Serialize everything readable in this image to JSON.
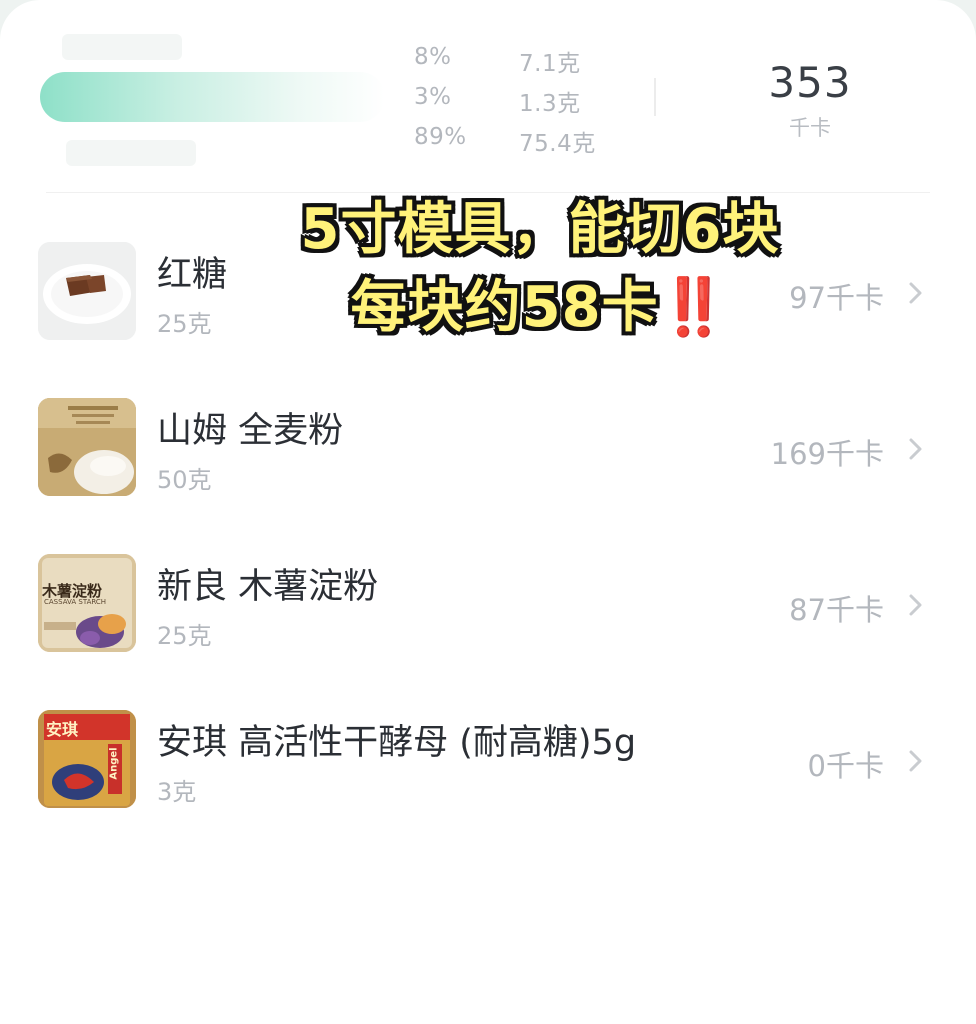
{
  "summary": {
    "macros": [
      {
        "pct": "8%",
        "grams": "7.1克"
      },
      {
        "pct": "3%",
        "grams": "1.3克"
      },
      {
        "pct": "89%",
        "grams": "75.4克"
      }
    ],
    "total_kcal": "353",
    "kcal_unit": "千卡"
  },
  "overlay": {
    "line1": "5寸模具，能切6块",
    "line2": "每块约58卡",
    "emoji": "‼️"
  },
  "foods": [
    {
      "name": "红糖",
      "weight": "25克",
      "kcal": "97千卡",
      "icon": "brown-sugar-photo"
    },
    {
      "name": "山姆 全麦粉",
      "weight": "50克",
      "kcal": "169千卡",
      "icon": "whole-wheat-flour-photo"
    },
    {
      "name": "新良 木薯淀粉",
      "weight": "25克",
      "kcal": "87千卡",
      "icon": "tapioca-starch-photo"
    },
    {
      "name": "安琪 高活性干酵母 (耐高糖)5g",
      "weight": "3克",
      "kcal": "0千卡",
      "icon": "yeast-packet-photo"
    }
  ],
  "thumb_texts": {
    "starch_title": "木薯淀粉",
    "starch_sub": "CASSAVA STARCH",
    "yeast_brand": "安琪",
    "yeast_logo": "Angel"
  }
}
